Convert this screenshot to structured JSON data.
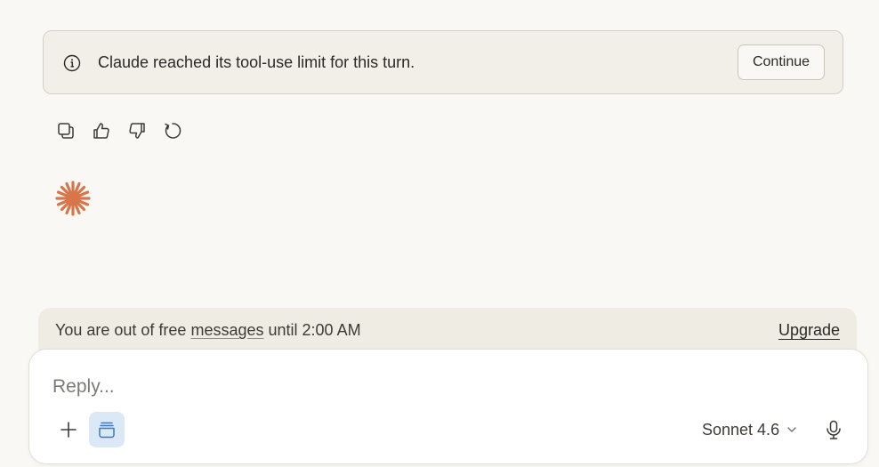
{
  "notice": {
    "text": "Claude reached its tool-use limit for this turn.",
    "continue_label": "Continue",
    "icon": "info-icon"
  },
  "message_actions": [
    {
      "name": "copy-button",
      "icon": "copy-icon"
    },
    {
      "name": "thumbs-up-button",
      "icon": "thumbs-up-icon"
    },
    {
      "name": "thumbs-down-button",
      "icon": "thumbs-down-icon"
    },
    {
      "name": "retry-button",
      "icon": "retry-icon"
    }
  ],
  "logo": {
    "icon": "claude-spark-icon",
    "color": "#d9754a"
  },
  "quota": {
    "prefix": "You are out of free ",
    "link": "messages",
    "suffix": " until 2:00 AM",
    "upgrade_label": "Upgrade"
  },
  "composer": {
    "placeholder": "Reply...",
    "model": "Sonnet 4.6",
    "add_icon": "plus-icon",
    "project_icon": "project-icon",
    "model_icon": "chevron-down-icon",
    "mic_icon": "microphone-icon"
  },
  "colors": {
    "background": "#f9f8f5",
    "accent": "#d9754a",
    "project_button_bg": "#dbe8f6",
    "project_icon": "#3a78c4"
  }
}
